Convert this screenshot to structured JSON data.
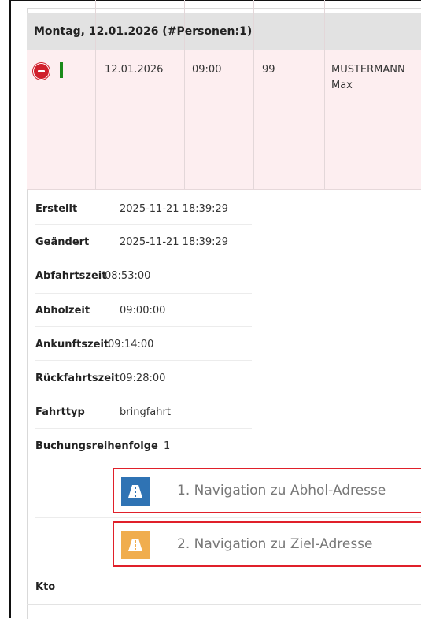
{
  "day_header": "Montag, 12.01.2026 (#Personen:1)",
  "booking": {
    "date": "12.01.2026",
    "time": "09:00",
    "number": "99",
    "name_line1": "MUSTERMANN",
    "name_line2": "Max",
    "status_color": "#1a8a1a"
  },
  "details": [
    {
      "label": "Erstellt",
      "value": "2025-11-21 18:39:29"
    },
    {
      "label": "Geändert",
      "value": "2025-11-21 18:39:29"
    },
    {
      "label": "Abfahrtszeit",
      "value": "08:53:00"
    },
    {
      "label": "Abholzeit",
      "value": "09:00:00"
    },
    {
      "label": "Ankunftszeit",
      "value": "09:14:00"
    },
    {
      "label": "Rückfahrtszeit",
      "value": "09:28:00"
    },
    {
      "label": "Fahrttyp",
      "value": "bringfahrt"
    },
    {
      "label": "Buchungsreihenfolge",
      "value": "1"
    }
  ],
  "navigation": [
    {
      "label": "1. Navigation zu Abhol-Adresse",
      "icon": "road-icon",
      "color": "#2f73b4"
    },
    {
      "label": "2. Navigation zu Ziel-Adresse",
      "icon": "road-icon",
      "color": "#f0ad4e"
    }
  ],
  "kto_label": "Kto"
}
